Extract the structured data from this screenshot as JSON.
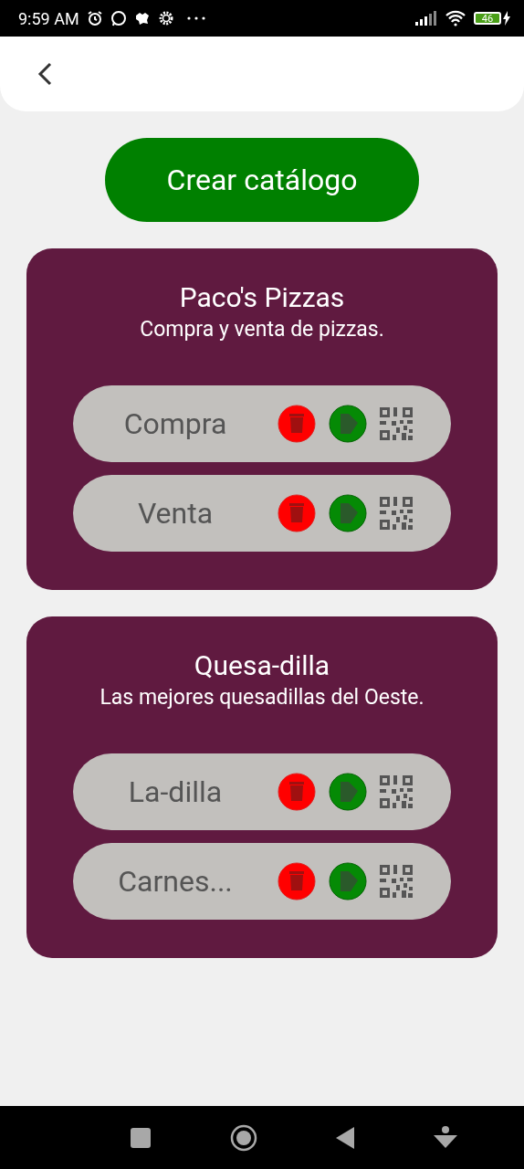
{
  "status_bar": {
    "time": "9:59 AM",
    "battery": "46"
  },
  "create_button": {
    "label": "Crear catálogo"
  },
  "catalogs": [
    {
      "title": "Paco's Pizzas",
      "description": "Compra y venta de pizzas.",
      "items": [
        {
          "label": "Compra"
        },
        {
          "label": "Venta"
        }
      ]
    },
    {
      "title": "Quesa-dilla",
      "description": "Las mejores quesadillas del Oeste.",
      "items": [
        {
          "label": "La-dilla"
        },
        {
          "label": "Carnes..."
        }
      ]
    }
  ]
}
